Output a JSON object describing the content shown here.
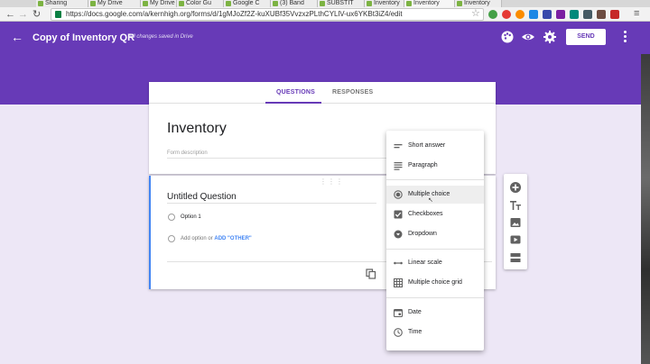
{
  "browser": {
    "tabs": [
      "Sharing",
      "My Drive",
      "My Drive",
      "Color Gu",
      "Google C",
      "(3) Band",
      "SUBSTIT",
      "Inventory",
      "Inventory",
      "Inventory"
    ],
    "url": "https://docs.google.com/a/kernhigh.org/forms/d/1gMJoZf2Z-kuXUBf35VvzxzPLthCYLlV-ux6YKBt3iZ4/edit"
  },
  "header": {
    "title": "Copy of Inventory QR",
    "save_status": "All changes saved in Drive",
    "send_label": "SEND"
  },
  "form": {
    "tabs": {
      "questions": "QUESTIONS",
      "responses": "RESPONSES"
    },
    "title": "Inventory",
    "description_placeholder": "Form description"
  },
  "question": {
    "title": "Untitled Question",
    "option_1": "Option 1",
    "add_option": "Add option",
    "or_text": "or",
    "add_other": "ADD \"OTHER\""
  },
  "type_menu": {
    "items": [
      {
        "label": "Short answer",
        "icon": "short-answer-icon"
      },
      {
        "label": "Paragraph",
        "icon": "paragraph-icon"
      },
      {
        "label": "Multiple choice",
        "icon": "radio-filled-icon",
        "selected": true
      },
      {
        "label": "Checkboxes",
        "icon": "checkbox-icon"
      },
      {
        "label": "Dropdown",
        "icon": "dropdown-icon"
      },
      {
        "label": "Linear scale",
        "icon": "linear-scale-icon"
      },
      {
        "label": "Multiple choice grid",
        "icon": "grid-icon"
      },
      {
        "label": "Date",
        "icon": "calendar-icon"
      },
      {
        "label": "Time",
        "icon": "clock-icon"
      }
    ]
  },
  "colors": {
    "brand": "#673ab7",
    "background": "#ede7f6",
    "accent_blue": "#4285f4"
  }
}
